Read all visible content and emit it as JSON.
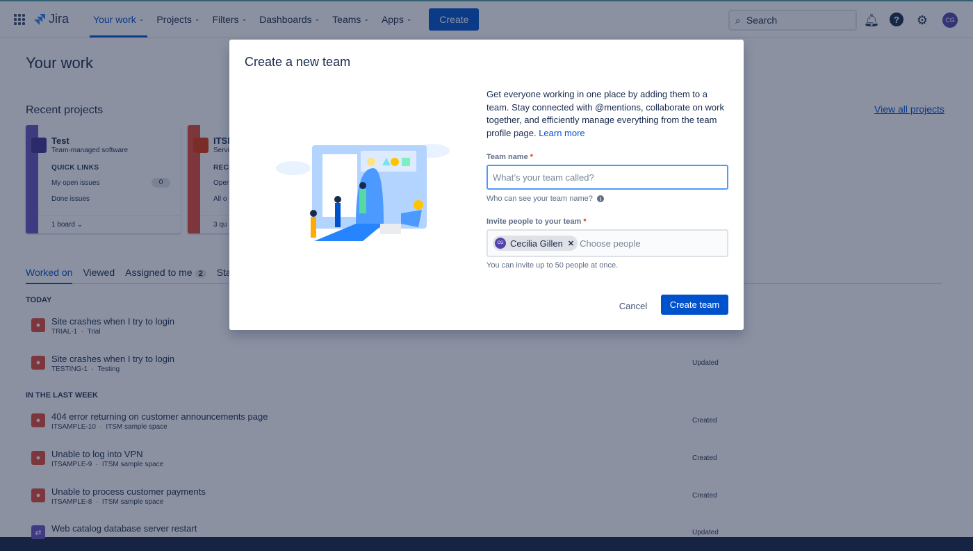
{
  "nav": {
    "product": "Jira",
    "items": [
      {
        "label": "Your work"
      },
      {
        "label": "Projects"
      },
      {
        "label": "Filters"
      },
      {
        "label": "Dashboards"
      },
      {
        "label": "Teams"
      },
      {
        "label": "Apps"
      }
    ],
    "create": "Create",
    "search_placeholder": "Search",
    "avatar": "CG"
  },
  "page": {
    "title": "Your work",
    "recent_title": "Recent projects",
    "view_all": "View all projects"
  },
  "projects": [
    {
      "name": "Test",
      "type": "Team-managed software",
      "section": "QUICK LINKS",
      "link1": "My open issues",
      "count": "0",
      "link2": "Done issues",
      "footer": "1 board ⌄",
      "color": "#6554c0"
    },
    {
      "name": "ITSM",
      "type": "Service",
      "section": "RECENT",
      "link1": "Open",
      "link2": "All o",
      "footer": "3 qu",
      "color": "#e5493a"
    }
  ],
  "tabs": [
    {
      "label": "Worked on"
    },
    {
      "label": "Viewed"
    },
    {
      "label": "Assigned to me",
      "badge": "2"
    },
    {
      "label": "Sta"
    }
  ],
  "groups": {
    "today": "TODAY",
    "week": "IN THE LAST WEEK"
  },
  "items": [
    {
      "title": "Site crashes when I try to login",
      "key": "TRIAL-1",
      "project": "Trial",
      "status": ""
    },
    {
      "title": "Site crashes when I try to login",
      "key": "TESTING-1",
      "project": "Testing",
      "status": "Updated"
    },
    {
      "title": "404 error returning on customer announcements page",
      "key": "ITSAMPLE-10",
      "project": "ITSM sample space",
      "status": "Created"
    },
    {
      "title": "Unable to log into VPN",
      "key": "ITSAMPLE-9",
      "project": "ITSM sample space",
      "status": "Created"
    },
    {
      "title": "Unable to process customer payments",
      "key": "ITSAMPLE-8",
      "project": "ITSM sample space",
      "status": "Created"
    },
    {
      "title": "Web catalog database server restart",
      "key": "",
      "project": "",
      "status": "Updated"
    }
  ],
  "modal": {
    "title": "Create a new team",
    "description": "Get everyone working in one place by adding them to a team. Stay connected with @mentions, collaborate on work together, and efficiently manage everything from the team profile page.",
    "learn_more": "Learn more",
    "team_name_label": "Team name",
    "team_name_placeholder": "What’s your team called?",
    "team_name_help": "Who can see your team name?",
    "invite_label": "Invite people to your team",
    "invitee": {
      "name": "Cecilia Gillen",
      "initials": "CG"
    },
    "invite_placeholder": "Choose people",
    "invite_help": "You can invite up to 50 people at once.",
    "cancel": "Cancel",
    "submit": "Create team",
    "required_mark": "*"
  }
}
